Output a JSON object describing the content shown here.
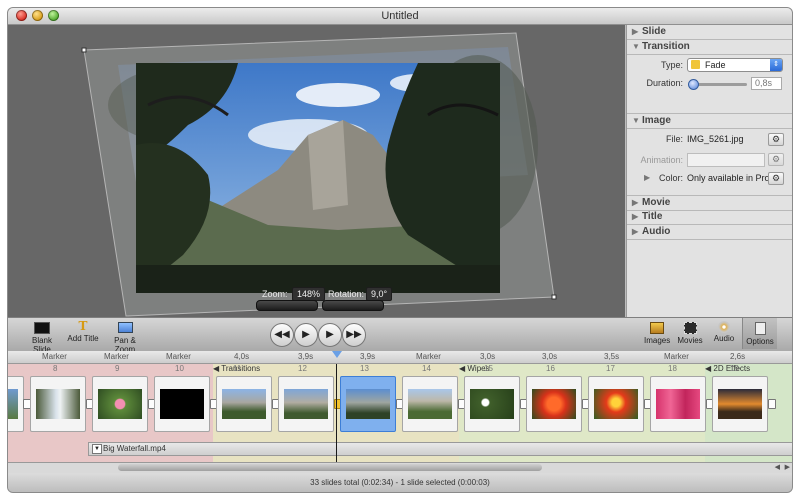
{
  "window": {
    "title": "Untitled"
  },
  "canvas": {
    "zoom_label": "Zoom:",
    "zoom_value": "148%",
    "rotation_label": "Rotation:",
    "rotation_value": "9,0°"
  },
  "inspector": {
    "slide": {
      "header": "Slide"
    },
    "transition": {
      "header": "Transition",
      "type_label": "Type:",
      "type_value": "Fade",
      "duration_label": "Duration:",
      "duration_value": "0,8s",
      "duration_level": 0.05
    },
    "image": {
      "header": "Image",
      "file_label": "File:",
      "file_value": "IMG_5261.jpg",
      "animation_label": "Animation:",
      "color_label": "Color:",
      "color_value": "Only available in Pro"
    },
    "movie": {
      "header": "Movie"
    },
    "title": {
      "header": "Title"
    },
    "audio": {
      "header": "Audio"
    }
  },
  "toolbar": {
    "blank_slide": "Blank Slide",
    "add_title": "Add Title",
    "pan_zoom": "Pan & Zoom",
    "images": "Images",
    "movies": "Movies",
    "audio": "Audio",
    "options": "Options"
  },
  "ruler": [
    "Marker",
    "Marker",
    "Marker",
    "4,0s",
    "3,9s",
    "3,9s",
    "Marker",
    "3,0s",
    "3,0s",
    "3,5s",
    "Marker",
    "2,6s"
  ],
  "groups": [
    "Transitions",
    "Wipes",
    "2D Effects"
  ],
  "slide_numbers": [
    "8",
    "9",
    "10",
    "11",
    "12",
    "13",
    "14",
    "15",
    "16",
    "17",
    "18",
    "19"
  ],
  "audio_clip": "Big Waterfall.mp4",
  "status": "33 slides total (0:02:34)  -  1 slide selected (0:00:03)",
  "colors": {
    "selection": "#7fb0ee",
    "accent": "#2a69d6",
    "band_pink": "#e8c7c7",
    "band_yellow": "#e8e3c2",
    "band_green": "#d4e6c8"
  }
}
